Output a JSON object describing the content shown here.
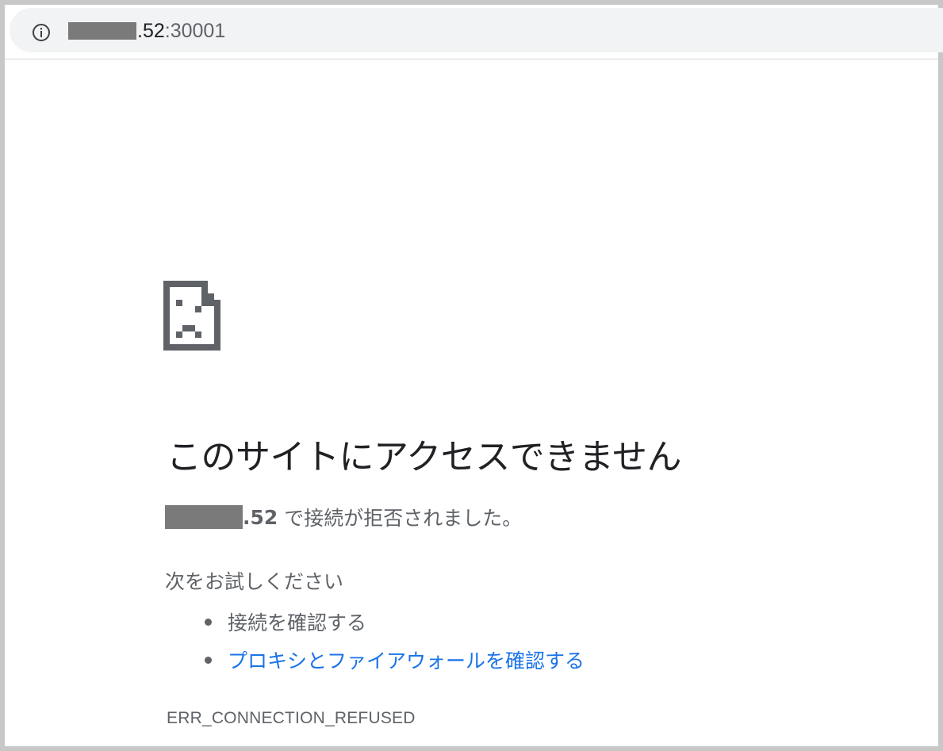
{
  "address_bar": {
    "info_icon": "info-icon",
    "url_host_suffix": ".52",
    "url_port": ":30001"
  },
  "error_page": {
    "icon": "sad-page-icon",
    "title": "このサイトにアクセスできません",
    "host_suffix": ".52",
    "detail_message": "で接続が拒否されました。",
    "suggestions_heading": "次をお試しください",
    "suggestions": [
      {
        "label": "接続を確認する",
        "is_link": false
      },
      {
        "label": "プロキシとファイアウォールを確認する",
        "is_link": true
      }
    ],
    "error_code": "ERR_CONNECTION_REFUSED"
  },
  "colors": {
    "text_primary": "#202124",
    "text_secondary": "#5f6368",
    "link": "#1a73e8",
    "omnibox_bg": "#f1f3f4",
    "redaction": "#7a7a7a",
    "frame_border": "#c8c8c8"
  }
}
